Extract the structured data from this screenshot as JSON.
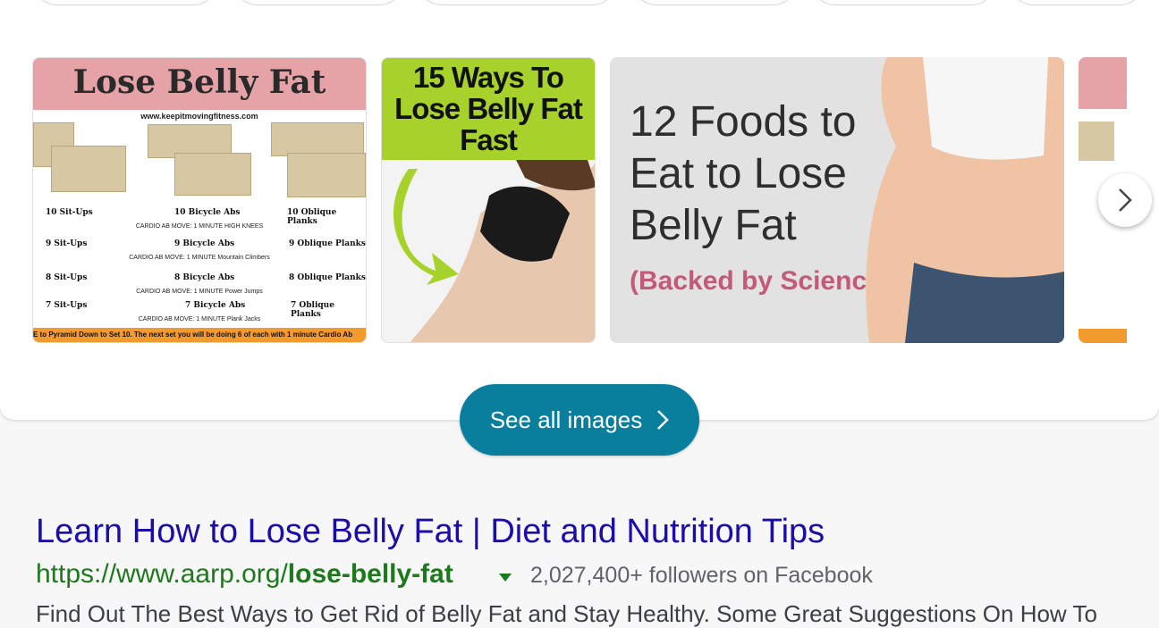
{
  "images": {
    "tile1": {
      "title": "Lose Belly Fat",
      "url": "www.keepitmovingfitness.com",
      "rows": [
        {
          "a": "10 Sit-Ups",
          "b": "10 Bicycle Abs",
          "c": "10 Oblique Planks",
          "sub": "CARDIO AB MOVE: 1 MINUTE  HIGH KNEES"
        },
        {
          "a": "9 Sit-Ups",
          "b": "9 Bicycle Abs",
          "c": "9 Oblique Planks",
          "sub": "CARDIO AB MOVE: 1 MINUTE  Mountain Climbers"
        },
        {
          "a": "8 Sit-Ups",
          "b": "8 Bicycle Abs",
          "c": "8 Oblique Planks",
          "sub": "CARDIO AB MOVE: 1 MINUTE  Power Jumps"
        },
        {
          "a": "7 Sit-Ups",
          "b": "7 Bicycle Abs",
          "c": "7 Oblique Planks",
          "sub": "CARDIO AB MOVE: 1 MINUTE  Plank Jacks"
        }
      ],
      "footer": "E to Pyramid Down to Set 10. The next set you will be doing 6 of each with 1 minute Cardio Ab"
    },
    "tile2": {
      "line1": "15 Ways To",
      "line2": "Lose Belly Fat",
      "line3": "Fast"
    },
    "tile3": {
      "line1": "12 Foods to",
      "line2": "Eat to Lose",
      "line3": "Belly Fat",
      "line4": "(Backed by Science)"
    }
  },
  "see_all": {
    "label": "See all images"
  },
  "result": {
    "title": "Learn How to Lose Belly Fat | Diet and Nutrition Tips",
    "url_prefix": "https://www.aarp.org/",
    "url_bold": "lose-belly-fat",
    "followers": "2,027,400+ followers on Facebook",
    "snippet": "Find Out The Best Ways to Get Rid of Belly Fat and Stay Healthy. Some Great Suggestions On How To"
  },
  "colors": {
    "link": "#1a0dab",
    "url": "#1c7a1c",
    "accent": "#0a7f9d"
  }
}
